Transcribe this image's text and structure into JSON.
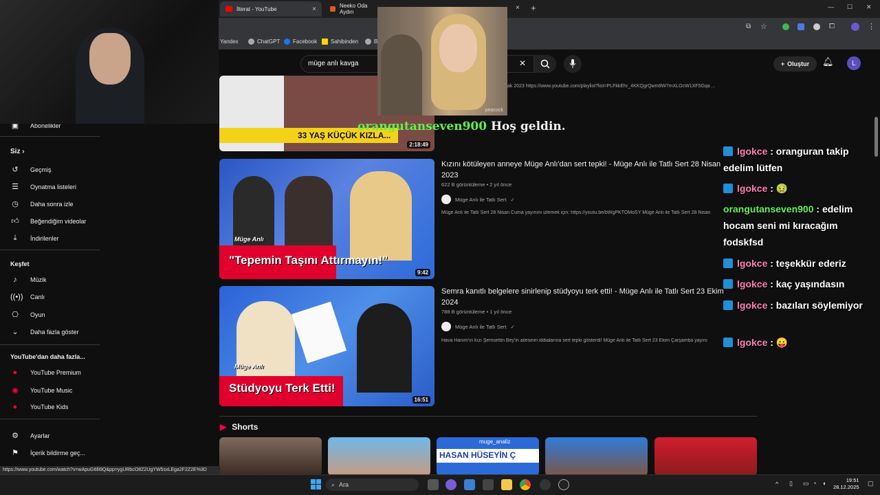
{
  "browser": {
    "tabs": [
      {
        "label": "İlterat - YouTube",
        "close": "×"
      },
      {
        "label": "Neeko Oda Aydın",
        "close": "×"
      }
    ],
    "tab3_close": "×",
    "new_tab": "+",
    "window_controls": [
      "—",
      "☐",
      "✕"
    ],
    "bookmarks": [
      "Yandex",
      "ChatGPT",
      "Facebook",
      "Sahibinden",
      "B"
    ]
  },
  "youtube": {
    "search_value": "müge anlı kavga",
    "search_clear": "✕",
    "create_label": "Oluştur",
    "avatar_letter": "L",
    "playlist_link": "ak 2023 https://www.youtube.com/playlist?list=PLFkkEhr_4KKQgrQwm8W7mXLOcW1XF5Gqa ..."
  },
  "sidebar": {
    "subscriptions": "Abonelikler",
    "you_header": "Siz",
    "you_items": [
      "Geçmiş",
      "Oynatma listeleri",
      "Daha sonra izle",
      "Beğendiğim videolar",
      "İndirilenler"
    ],
    "explore_header": "Keşfet",
    "explore_items": [
      "Müzik",
      "Canlı",
      "Oyun",
      "Daha fazla göster"
    ],
    "more_header": "YouTube'dan daha fazla...",
    "more_items": [
      "YouTube Premium",
      "YouTube Music",
      "YouTube Kids"
    ],
    "settings_items": [
      "Ayarlar",
      "İçerik bildirme geç..."
    ]
  },
  "results": [
    {
      "duration": "2:18:49",
      "caption": "33 YAŞ KÜÇÜK KIZLA..."
    },
    {
      "title": "Kızını kötüleyen anneye Müge Anlı'dan sert tepki! - Müge Anlı ile Tatlı Sert 28 Nisan 2023",
      "meta": "622 B görüntüleme • 2 yıl önce",
      "channel": "Müge Anlı ile Tatlı Sert",
      "desc": "Müge Anlı ile Tatlı Sert 28 Nisan Cuma yayınını izlemek için: https://youtu.be/bWgPKTOMoSY Müge Anlı ile Tatlı Sert 28 Nisan",
      "caption": "\"Tepemin Taşını Attırmayın!\"",
      "duration": "9:42"
    },
    {
      "title": "Semra kanıtlı belgelere sinirlenip stüdyoyu terk etti! - Müge Anlı ile Tatlı Sert 23 Ekim 2024",
      "meta": "788 B görüntüleme • 1 yıl önce",
      "channel": "Müge Anlı ile Tatlı Sert",
      "desc": "Hava Hanım'ın kızı Şemsettin Bey'in ailesinin iddialarına sert tepki gösterdi! Müge Anlı ile Tatlı Sert 23 Ekim Çarşamba yayını",
      "caption": "Stüdyoyu Terk Etti!",
      "duration": "16:51"
    }
  ],
  "thumb_brand": "Müge Anlı",
  "shorts": {
    "header": "Shorts",
    "short3_caption": "muge_analiz",
    "short3_text": "HASAN HÜSEYİN Ç"
  },
  "overlay": {
    "welcome_user": "orangutanseven900",
    "welcome_text": "Hoş geldin.",
    "popup_watermark": "peacock",
    "chat": [
      {
        "user": "lgokce",
        "msg": ": oranguran takip edelim lütfen",
        "color": "pink",
        "badge": true
      },
      {
        "user": "lgokce",
        "msg": ": 🤢",
        "color": "pink",
        "badge": true
      },
      {
        "user": "orangutanseven900",
        "msg": ": edelim hocam seni mi kıracağım fodskfsd",
        "color": "green",
        "badge": false
      },
      {
        "user": "lgokce",
        "msg": ": teşekkür ederiz",
        "color": "pink",
        "badge": true
      },
      {
        "user": "lgokce",
        "msg": ": kaç yaşındasın",
        "color": "pink",
        "badge": true
      },
      {
        "user": "lgokce",
        "msg": ": bazıları söylemiyor",
        "color": "pink",
        "badge": true
      },
      {
        "user": "lgokce",
        "msg": ": 😛",
        "color": "pink",
        "badge": true
      }
    ]
  },
  "status_url": "https://www.youtube.com/watch?v=wApuG6lli9Q&pp=ygURbcO8Z2UgYW5sxLEga2F2Z2E%3D",
  "taskbar": {
    "search_label": "Ara",
    "time": "19:51",
    "date": "28.12.2025"
  },
  "colors": {
    "accent_red": "#ff0033",
    "chat_pink": "#ff7fb0",
    "chat_green": "#67f25c",
    "badge_blue": "#1f8fd6"
  }
}
